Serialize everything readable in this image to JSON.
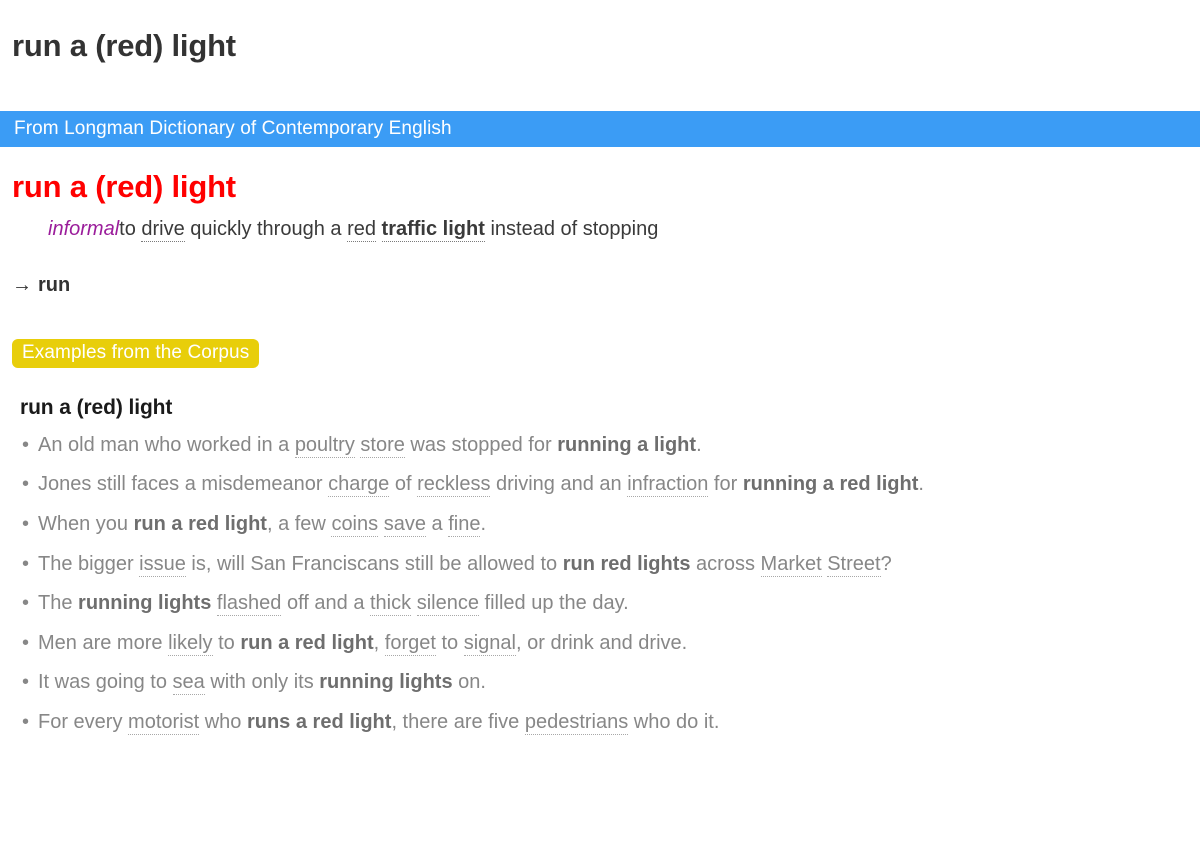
{
  "page": {
    "title": "run a (red) light"
  },
  "source_bar": {
    "text": "From Longman Dictionary of Contemporary English"
  },
  "entry": {
    "headword": "run a (red) light",
    "register": "informal",
    "definition_parts": [
      {
        "text": "to ",
        "style": "plain"
      },
      {
        "text": "drive",
        "style": "link"
      },
      {
        "text": " quickly through a ",
        "style": "plain"
      },
      {
        "text": "red",
        "style": "link"
      },
      {
        "text": " ",
        "style": "plain"
      },
      {
        "text": "traffic light",
        "style": "link-bold"
      },
      {
        "text": " instead of stopping",
        "style": "plain"
      }
    ],
    "crossref": {
      "arrow": "→",
      "target": "run"
    }
  },
  "corpus": {
    "badge_label": "Examples from the Corpus",
    "heading": "run a (red) light",
    "examples": [
      [
        {
          "text": "An old man who worked in a ",
          "style": "plain"
        },
        {
          "text": "poultry",
          "style": "link"
        },
        {
          "text": " ",
          "style": "plain"
        },
        {
          "text": "store",
          "style": "link"
        },
        {
          "text": " was stopped for ",
          "style": "plain"
        },
        {
          "text": "running a light",
          "style": "bold"
        },
        {
          "text": ".",
          "style": "plain"
        }
      ],
      [
        {
          "text": "Jones still faces a misdemeanor ",
          "style": "plain"
        },
        {
          "text": "charge",
          "style": "link"
        },
        {
          "text": " of ",
          "style": "plain"
        },
        {
          "text": "reckless",
          "style": "link"
        },
        {
          "text": " driving and an ",
          "style": "plain"
        },
        {
          "text": "infraction",
          "style": "link"
        },
        {
          "text": " for ",
          "style": "plain"
        },
        {
          "text": "running a red light",
          "style": "bold"
        },
        {
          "text": ".",
          "style": "plain"
        }
      ],
      [
        {
          "text": "When you ",
          "style": "plain"
        },
        {
          "text": "run a red light",
          "style": "bold"
        },
        {
          "text": ", a few ",
          "style": "plain"
        },
        {
          "text": "coins",
          "style": "link"
        },
        {
          "text": " ",
          "style": "plain"
        },
        {
          "text": "save",
          "style": "link"
        },
        {
          "text": " a ",
          "style": "plain"
        },
        {
          "text": "fine",
          "style": "link"
        },
        {
          "text": ".",
          "style": "plain"
        }
      ],
      [
        {
          "text": "The bigger ",
          "style": "plain"
        },
        {
          "text": "issue",
          "style": "link"
        },
        {
          "text": " is, will San Franciscans still be allowed to ",
          "style": "plain"
        },
        {
          "text": "run red lights",
          "style": "bold"
        },
        {
          "text": " across ",
          "style": "plain"
        },
        {
          "text": "Market",
          "style": "link"
        },
        {
          "text": " ",
          "style": "plain"
        },
        {
          "text": "Street",
          "style": "link"
        },
        {
          "text": "?",
          "style": "plain"
        }
      ],
      [
        {
          "text": "The ",
          "style": "plain"
        },
        {
          "text": "running lights",
          "style": "bold"
        },
        {
          "text": " ",
          "style": "plain"
        },
        {
          "text": "flashed",
          "style": "link"
        },
        {
          "text": " off and a ",
          "style": "plain"
        },
        {
          "text": "thick",
          "style": "link"
        },
        {
          "text": " ",
          "style": "plain"
        },
        {
          "text": "silence",
          "style": "link"
        },
        {
          "text": " filled up the day.",
          "style": "plain"
        }
      ],
      [
        {
          "text": "Men are more ",
          "style": "plain"
        },
        {
          "text": "likely",
          "style": "link"
        },
        {
          "text": " to ",
          "style": "plain"
        },
        {
          "text": "run a red light",
          "style": "bold"
        },
        {
          "text": ", ",
          "style": "plain"
        },
        {
          "text": "forget",
          "style": "link"
        },
        {
          "text": " to ",
          "style": "plain"
        },
        {
          "text": "signal",
          "style": "link"
        },
        {
          "text": ", or drink and drive.",
          "style": "plain"
        }
      ],
      [
        {
          "text": "It was going to ",
          "style": "plain"
        },
        {
          "text": "sea",
          "style": "link"
        },
        {
          "text": " with only its ",
          "style": "plain"
        },
        {
          "text": "running lights",
          "style": "bold"
        },
        {
          "text": " on.",
          "style": "plain"
        }
      ],
      [
        {
          "text": "For every ",
          "style": "plain"
        },
        {
          "text": "motorist",
          "style": "link"
        },
        {
          "text": " who ",
          "style": "plain"
        },
        {
          "text": "runs a red light",
          "style": "bold"
        },
        {
          "text": ", there are five ",
          "style": "plain"
        },
        {
          "text": "pedestrians",
          "style": "link"
        },
        {
          "text": " who do it.",
          "style": "plain"
        }
      ]
    ]
  },
  "colors": {
    "source_bar_blue": "#3b9cf5",
    "headword_red": "#ff0000",
    "register_purple": "#9b1d9b",
    "corpus_badge_yellow": "#e8ce0a",
    "example_gray": "#878787",
    "title_gray": "#333333"
  }
}
